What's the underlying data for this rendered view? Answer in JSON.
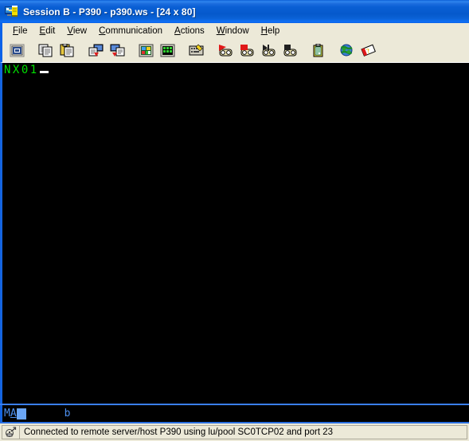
{
  "window": {
    "title": "Session B - P390 - p390.ws - [24 x 80]",
    "icon": "terminal-session-icon"
  },
  "menubar": {
    "items": [
      {
        "label": "File",
        "accel": "F"
      },
      {
        "label": "Edit",
        "accel": "E"
      },
      {
        "label": "View",
        "accel": "V"
      },
      {
        "label": "Communication",
        "accel": "C"
      },
      {
        "label": "Actions",
        "accel": "A"
      },
      {
        "label": "Window",
        "accel": "W"
      },
      {
        "label": "Help",
        "accel": "H"
      }
    ]
  },
  "toolbar": {
    "groups": [
      {
        "buttons": [
          {
            "icon": "display-session-icon",
            "label": "Display Session"
          }
        ]
      },
      {
        "buttons": [
          {
            "icon": "copy-icon",
            "label": "Copy"
          },
          {
            "icon": "paste-icon",
            "label": "Paste"
          }
        ]
      },
      {
        "buttons": [
          {
            "icon": "send-file-icon",
            "label": "Send File to Host"
          },
          {
            "icon": "receive-file-icon",
            "label": "Receive File from Host"
          }
        ]
      },
      {
        "buttons": [
          {
            "icon": "color-settings-icon",
            "label": "Color Settings"
          },
          {
            "icon": "keypad-icon",
            "label": "Keypad"
          }
        ]
      },
      {
        "buttons": [
          {
            "icon": "keyboard-remap-icon",
            "label": "Keyboard Remap"
          }
        ]
      },
      {
        "buttons": [
          {
            "icon": "record-macro-icon",
            "label": "Record Macro"
          },
          {
            "icon": "stop-record-macro-icon",
            "label": "Stop Recording Macro"
          },
          {
            "icon": "play-macro-icon",
            "label": "Play Macro"
          },
          {
            "icon": "stop-macro-icon",
            "label": "Stop Playing Macro"
          }
        ]
      },
      {
        "buttons": [
          {
            "icon": "clipboard-icon",
            "label": "Clipboard"
          }
        ]
      },
      {
        "buttons": [
          {
            "icon": "globe-icon",
            "label": "Internet"
          },
          {
            "icon": "help-book-icon",
            "label": "Help"
          }
        ]
      }
    ]
  },
  "terminal": {
    "rows": 24,
    "cols": 80,
    "foreground_color": "#00e000",
    "background_color": "#000000",
    "cursor_color": "#ffffff",
    "lines": [
      "NX01"
    ]
  },
  "oia": {
    "connection_indicator": "MA",
    "underlined_char": "A",
    "secondary_indicator": "b",
    "cursor_block_color": "#6ba6f5",
    "text_color": "#4d90f0"
  },
  "statusbar": {
    "icon": "connection-plug-icon",
    "message": "Connected to remote server/host P390 using lu/pool SC0TCP02 and port 23"
  }
}
